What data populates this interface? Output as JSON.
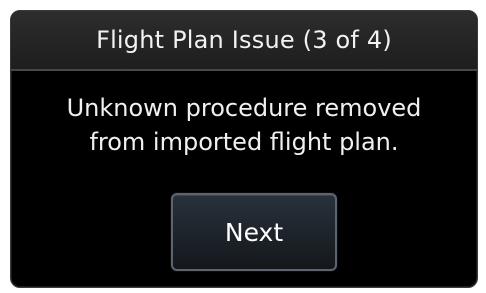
{
  "dialog": {
    "title": "Flight Plan Issue (3 of 4)",
    "message_lines": [
      "Unknown procedure removed",
      "from imported flight plan."
    ],
    "next_label": "Next"
  },
  "colors": {
    "background": "#000000",
    "title_bar": "#262626",
    "text": "#f2f2f2",
    "button_border": "#5c6470",
    "button_fill": "#1d232a"
  }
}
